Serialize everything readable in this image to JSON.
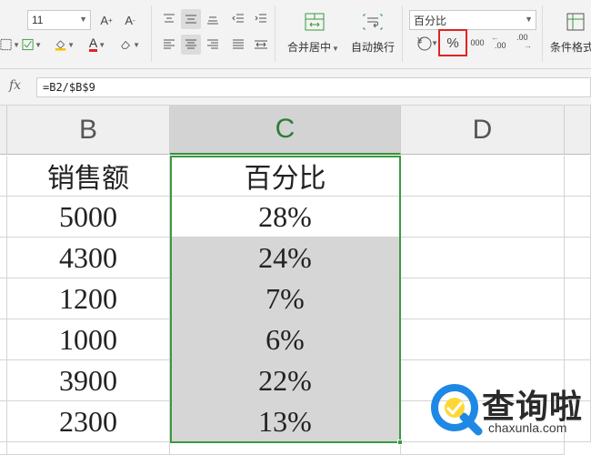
{
  "ribbon": {
    "font_size": "11",
    "number_format": "百分比",
    "merge_center_label": "合并居中",
    "auto_wrap_label": "自动换行",
    "cond_format_label": "条件格式",
    "font_grow": "A",
    "font_shrink": "A",
    "font_color_letter": "A",
    "percent_symbol": "%",
    "thousands_label": "000",
    "inc_decimal_label": ".00",
    "dec_decimal_label": ".00",
    "currency_symbol": "¥",
    "highlight_color": "#e02424"
  },
  "formula_bar": {
    "fx": "fx",
    "formula": "=B2/$B$9"
  },
  "columns": {
    "B": "B",
    "C": "C",
    "D": "D"
  },
  "table": {
    "header_b": "销售额",
    "header_c": "百分比",
    "rows": [
      {
        "b": "5000",
        "c": "28%"
      },
      {
        "b": "4300",
        "c": "24%"
      },
      {
        "b": "1200",
        "c": "7%"
      },
      {
        "b": "1000",
        "c": "6%"
      },
      {
        "b": "3900",
        "c": "22%"
      },
      {
        "b": "2300",
        "c": "13%"
      }
    ]
  },
  "watermark": {
    "brand": "查询啦",
    "url": "chaxunla.com"
  },
  "colors": {
    "selection": "#3a9a3e",
    "active_header": "#d3d3d3"
  }
}
